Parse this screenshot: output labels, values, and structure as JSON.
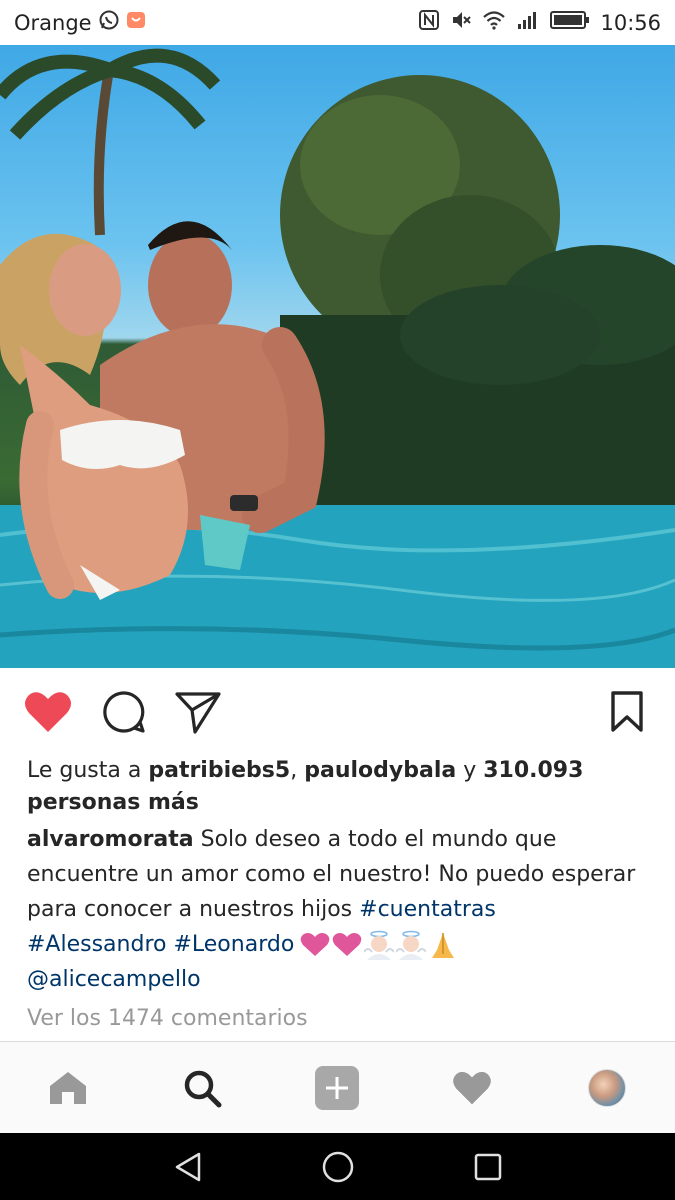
{
  "status_bar": {
    "carrier": "Orange",
    "time": "10:56",
    "icons": [
      "whatsapp-icon",
      "notification-icon",
      "nfc-icon",
      "mute-icon",
      "wifi-icon",
      "signal-icon",
      "battery-icon"
    ]
  },
  "post": {
    "image_alt_icon": "photo",
    "actions": [
      "heart-filled-icon",
      "comment-icon",
      "share-icon",
      "bookmark-icon"
    ],
    "like_color": "#ed4956",
    "likes": {
      "prefix": "Le gusta a ",
      "user1": "patribiebs5",
      "sep": ", ",
      "user2": "paulodybala",
      "conj": " y ",
      "count": "310.093",
      "suffix": "personas más"
    },
    "caption": {
      "username": "alvaromorata",
      "text": " Solo deseo a todo el mundo que encuentre un amor como el nuestro! No puedo esperar para conocer a nuestros hijos ",
      "hashtag1": "#cuentatras",
      "hashtag2": "#Alessandro",
      "hashtag3": "#Leonardo",
      "mention": "@alicecampello",
      "emojis": [
        "pink-heart-icon",
        "pink-heart-icon",
        "baby-angel-icon",
        "baby-angel-icon",
        "folded-hands-icon"
      ]
    },
    "comments_link": "Ver los 1474 comentarios"
  },
  "bottom_nav": {
    "items": [
      "home-icon",
      "search-icon",
      "add-icon",
      "heart-icon",
      "profile-avatar"
    ]
  },
  "system_nav": {
    "items": [
      "back-icon",
      "home-circle-icon",
      "recents-icon"
    ]
  }
}
